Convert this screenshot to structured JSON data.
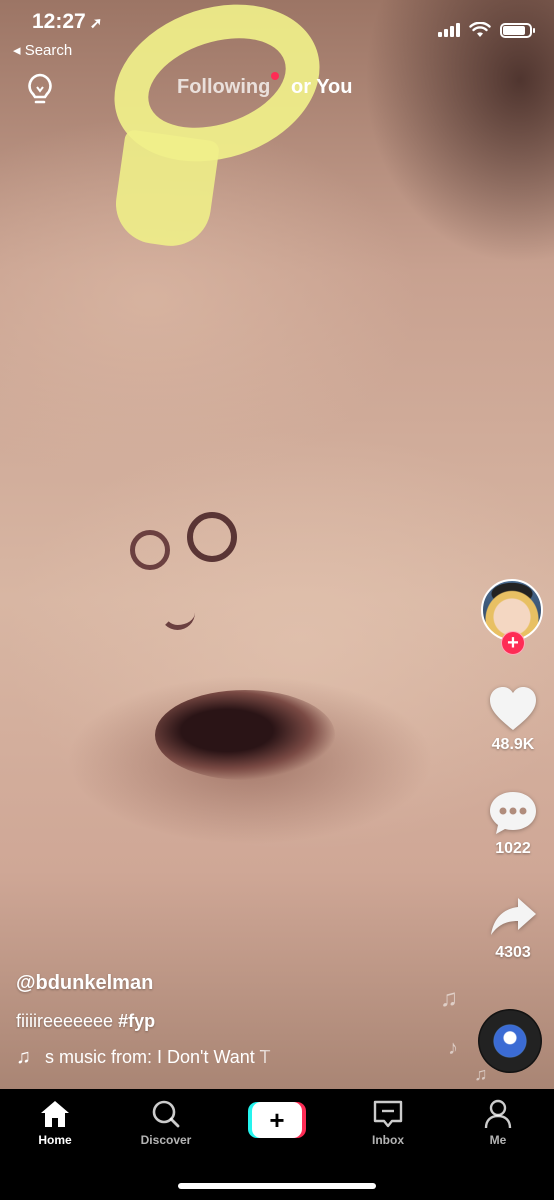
{
  "status_bar": {
    "time": "12:27",
    "back_label": "◂ Search"
  },
  "top_nav": {
    "following": "Following",
    "for_you": "or You"
  },
  "right_rail": {
    "likes": "48.9K",
    "comments": "1022",
    "shares": "4303"
  },
  "post": {
    "username": "@bdunkelman",
    "caption_text": "fiiiireeeeeee",
    "caption_hashtag": "#fyp",
    "music": "s music from: I Don't Want T"
  },
  "tab_bar": {
    "home": "Home",
    "discover": "Discover",
    "create": "+",
    "inbox": "Inbox",
    "me": "Me"
  },
  "colors": {
    "accent_red": "#fe2c55",
    "accent_cyan": "#25f4ee",
    "filter_yellow": "#f0f08a"
  },
  "icons": [
    "location-arrow-icon",
    "signal-icon",
    "wifi-icon",
    "battery-icon",
    "lightbulb-icon",
    "plus-icon",
    "heart-icon",
    "comment-icon",
    "share-icon",
    "music-note-icon",
    "home-icon",
    "search-icon",
    "inbox-icon",
    "profile-icon"
  ]
}
